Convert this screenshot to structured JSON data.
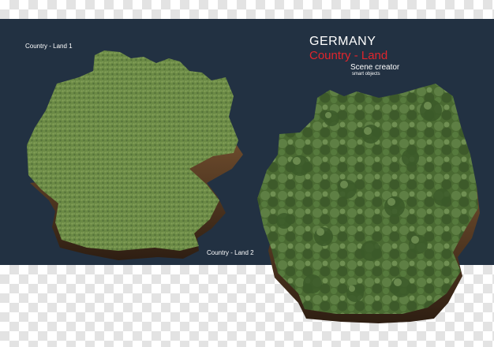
{
  "labels": {
    "land1": "Country - Land 1",
    "land2": "Country - Land 2"
  },
  "title": {
    "country": "GERMANY",
    "subtitle": "Country - Land",
    "scene_creator": "Scene creator",
    "smart_objects": "smart objects"
  },
  "colors": {
    "panel": "#223142",
    "grass": "#5f7e3e",
    "forest": "#4f6e36",
    "soil": "#5a3a22",
    "subtitle": "#e0252c"
  }
}
